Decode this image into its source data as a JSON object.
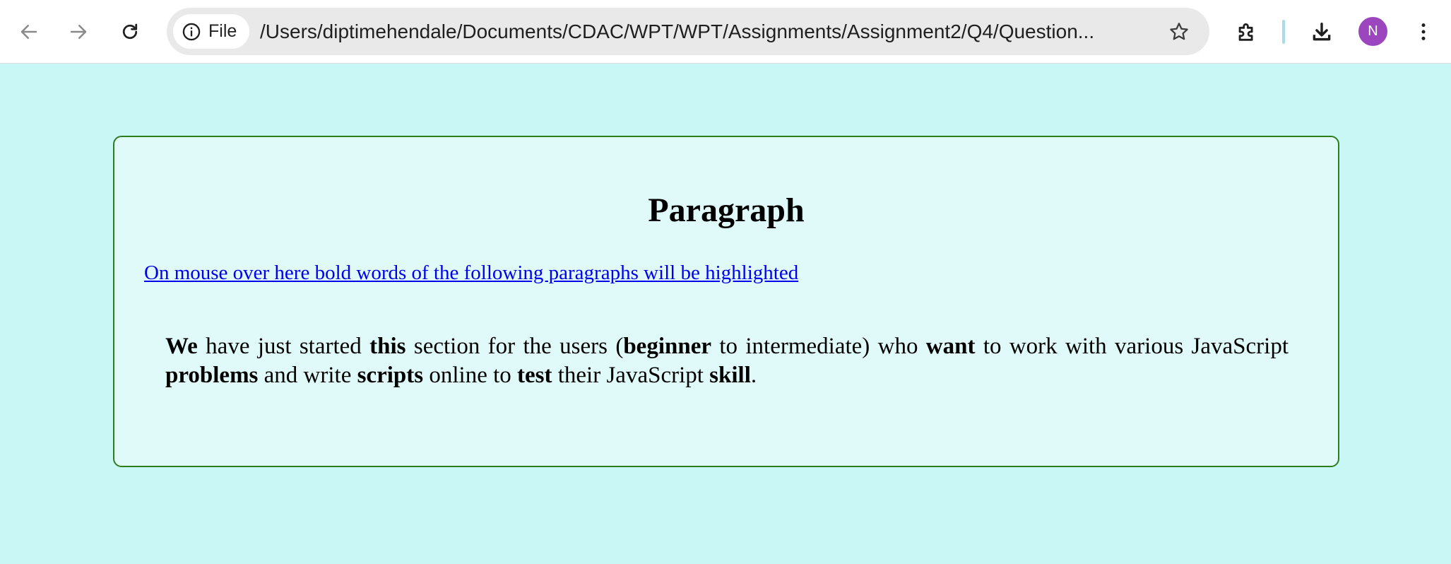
{
  "browser": {
    "back_icon": "arrow-left-icon",
    "forward_icon": "arrow-right-icon",
    "reload_icon": "reload-icon",
    "chip_label": "File",
    "url": "/Users/diptimehendale/Documents/CDAC/WPT/WPT/Assignments/Assignment2/Q4/Question...",
    "bookmark_icon": "star-icon",
    "extensions_icon": "puzzle-icon",
    "download_icon": "download-icon",
    "profile_initial": "N",
    "profile_color": "#9b45bf",
    "menu_icon": "kebab-menu-icon"
  },
  "page": {
    "background": "#c8f7f6",
    "panel_background": "#e0fafa",
    "panel_border": "#2e7d1f",
    "heading": "Paragraph",
    "link_text": "On mouse over here bold words of the following paragraphs will be highlighted",
    "paragraph": [
      {
        "t": "We",
        "b": true
      },
      {
        "t": " have just started ",
        "b": false
      },
      {
        "t": "this",
        "b": true
      },
      {
        "t": " section for the users (",
        "b": false
      },
      {
        "t": "beginner",
        "b": true
      },
      {
        "t": " to intermediate) who ",
        "b": false
      },
      {
        "t": "want",
        "b": true
      },
      {
        "t": " to work with various JavaScript ",
        "b": false
      },
      {
        "t": "problems",
        "b": true
      },
      {
        "t": " and write ",
        "b": false
      },
      {
        "t": "scripts",
        "b": true
      },
      {
        "t": " online to ",
        "b": false
      },
      {
        "t": "test",
        "b": true
      },
      {
        "t": " their JavaScript ",
        "b": false
      },
      {
        "t": "skill",
        "b": true
      },
      {
        "t": ".",
        "b": false
      }
    ]
  }
}
